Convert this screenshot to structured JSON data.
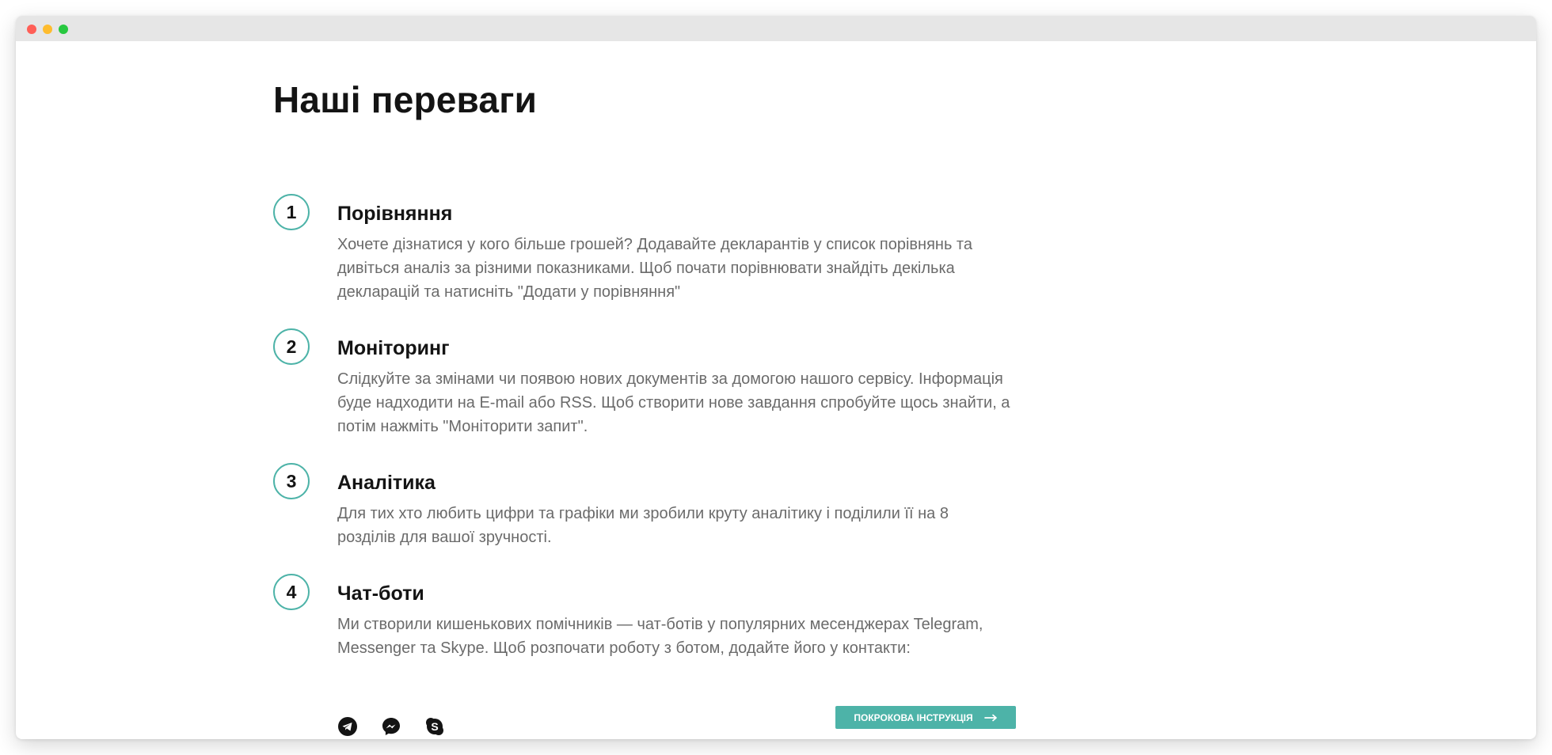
{
  "section": {
    "title": "Наші переваги"
  },
  "features": [
    {
      "number": "1",
      "title": "Порівняння",
      "description": "Хочете дізнатися у кого більше грошей? Додавайте декларантів у список порівнянь та дивіться аналіз за різними показниками. Щоб почати порівнювати знайдіть декілька декларацій та натисніть \"Додати у порівняння\""
    },
    {
      "number": "2",
      "title": "Моніторинг",
      "description": "Слідкуйте за змінами чи появою нових документів за домогою нашого сервісу. Інформація буде надходити на E-mail або RSS. Щоб створити нове завдання спробуйте щось знайти, а потім нажміть \"Моніторити запит\"."
    },
    {
      "number": "3",
      "title": "Аналітика",
      "description": "Для тих хто любить цифри та графіки ми зробили круту аналітику і поділили її на 8 розділів для вашої зручності."
    },
    {
      "number": "4",
      "title": "Чат-боти",
      "description": "Ми створили кишенькових помічників — чат-ботів у популярних месенджерах Telegram, Messenger та Skype. Щоб розпочати роботу з ботом, додайте його у контакти:"
    }
  ],
  "social": {
    "icons": [
      "telegram-icon",
      "messenger-icon",
      "skype-icon"
    ]
  },
  "guide_button": {
    "label": "ПОКРОКОВА ІНСТРУКЦІЯ",
    "icon": "arrow-right-icon"
  },
  "colors": {
    "accent": "#4db3a8",
    "title": "#141414",
    "body_text": "#6b6b6b"
  }
}
